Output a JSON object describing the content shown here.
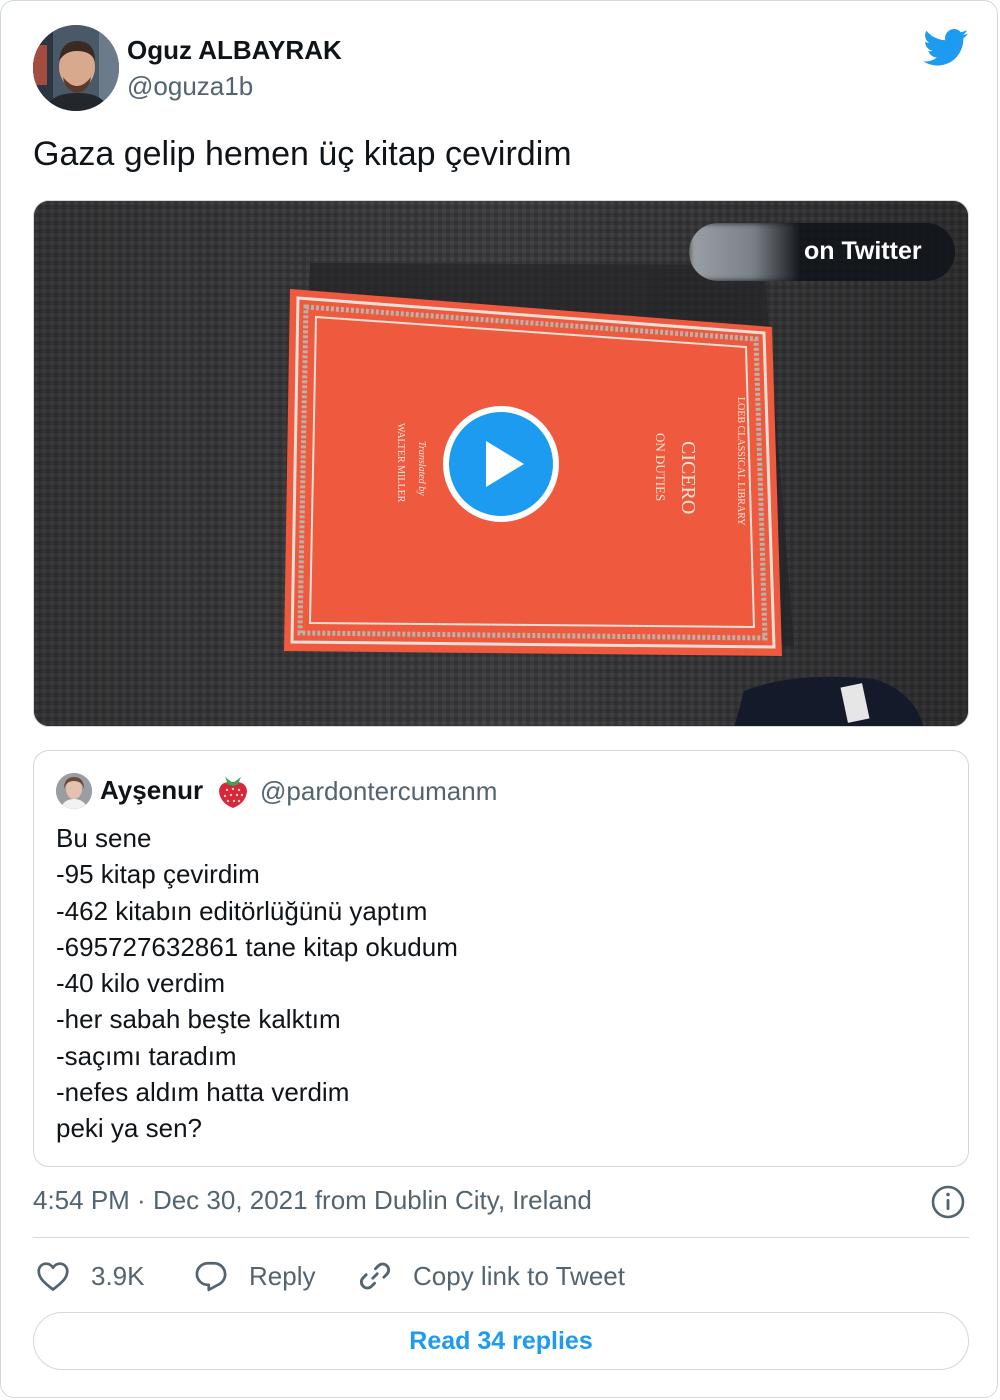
{
  "author": {
    "name": "Oguz ALBAYRAK",
    "handle": "@oguza1b"
  },
  "tweet": {
    "text": "Gaza gelip hemen üç kitap çevirdim"
  },
  "media": {
    "type": "video",
    "watch_label": "on Twitter",
    "book_title": "CICERO",
    "book_subtitle": "ON DUTIES",
    "book_series": "LOEB CLASSICAL LIBRARY",
    "book_translator_intro": "Translated by",
    "book_translator": "WALTER MILLER"
  },
  "quote": {
    "name": "Ayşenur",
    "emoji": "strawberry-icon",
    "handle": "@pardontercumanm",
    "lines": [
      "Bu sene",
      "-95 kitap çevirdim",
      "-462 kitabın editörlüğünü yaptım",
      "-695727632861 tane kitap okudum",
      "-40 kilo verdim",
      "-her sabah beşte kalktım",
      "-saçımı taradım",
      "-nefes aldım hatta verdim",
      "peki ya sen?"
    ]
  },
  "meta": {
    "time": "4:54 PM",
    "separator": " · ",
    "date": "Dec 30, 2021",
    "location": " from Dublin City, Ireland"
  },
  "actions": {
    "like_count": "3.9K",
    "reply_label": "Reply",
    "copy_label": "Copy link to Tweet"
  },
  "read_replies": "Read 34 replies",
  "colors": {
    "brand": "#1d9bf0",
    "text": "#0f1419",
    "muted": "#536471",
    "border": "#cfd9de",
    "book_red": "#ef5a3e"
  }
}
